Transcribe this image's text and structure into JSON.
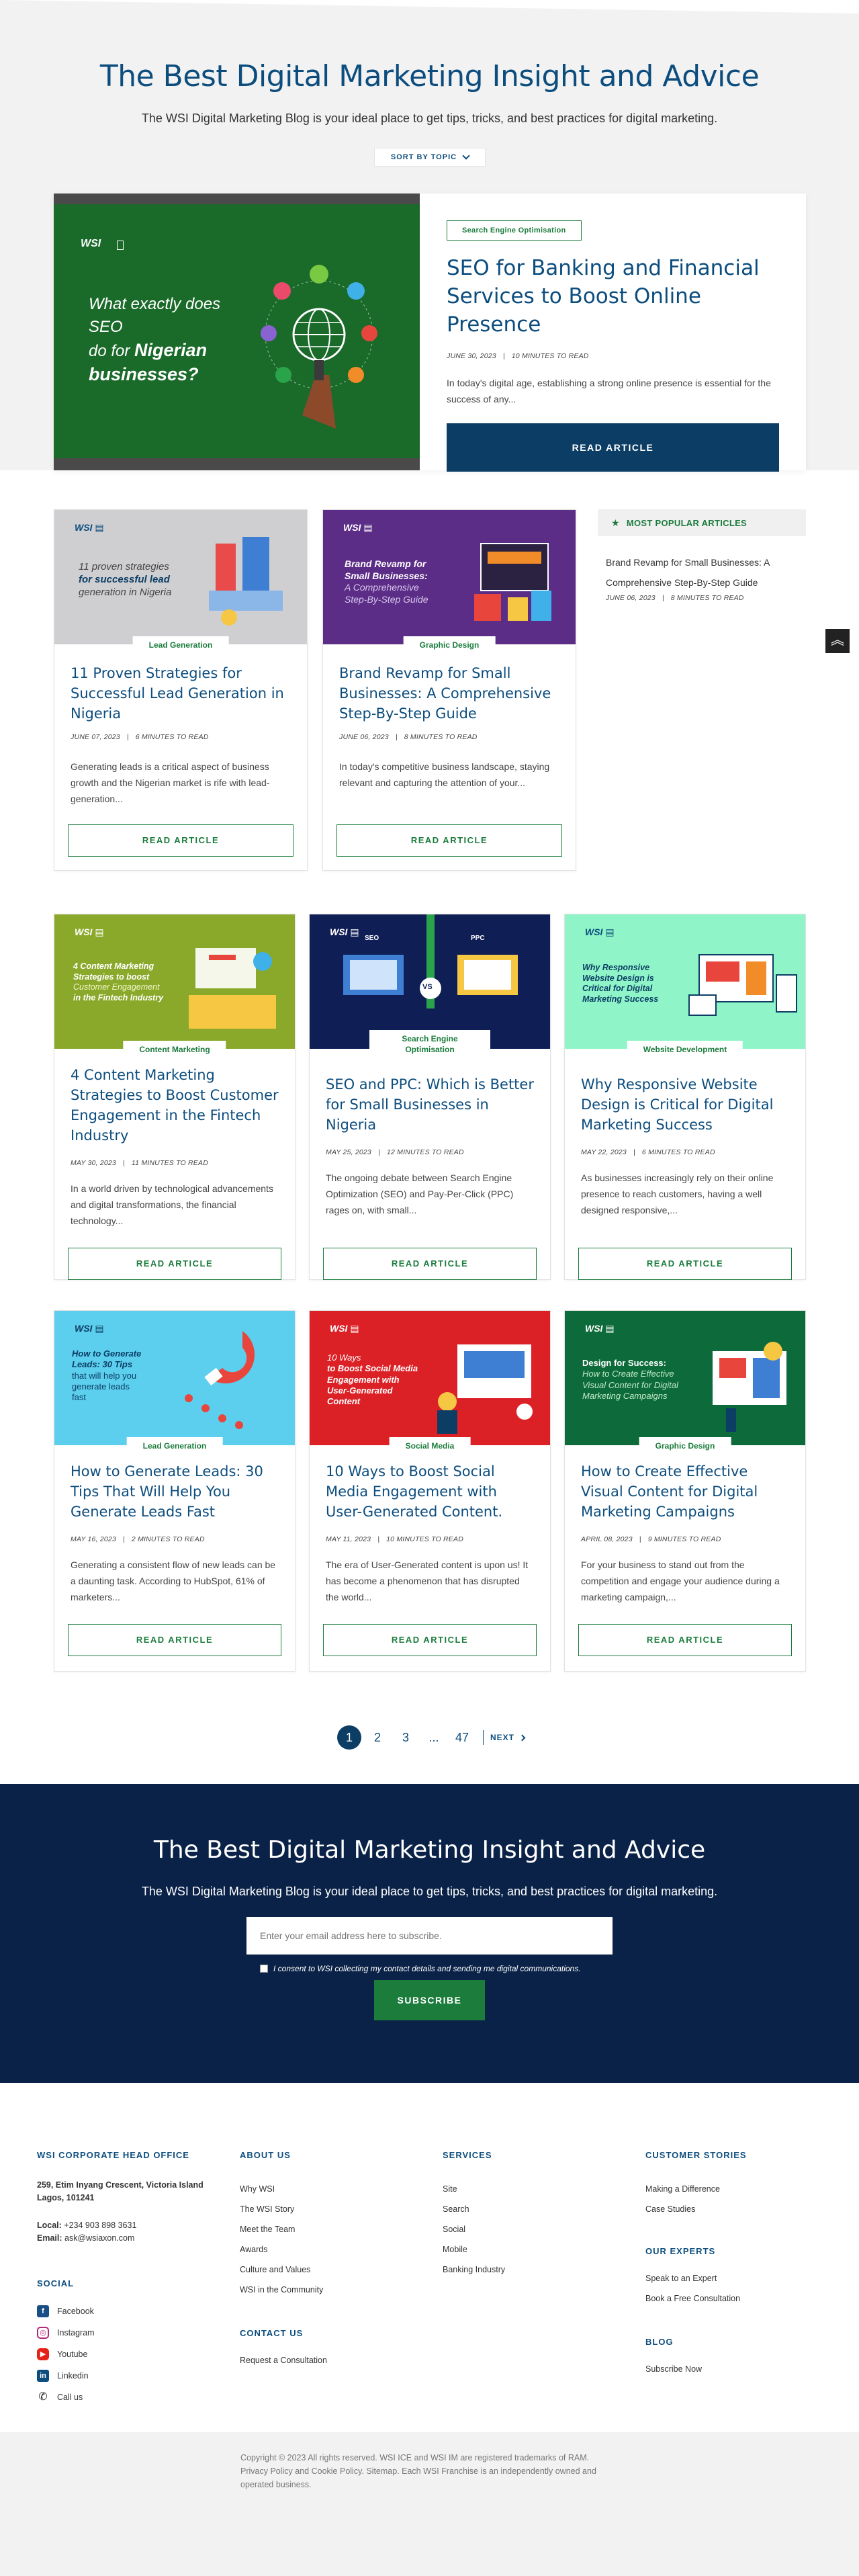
{
  "hero": {
    "title": "The Best Digital Marketing Insight and Advice",
    "subtitle": "The WSI Digital Marketing Blog is your ideal place to get tips, tricks, and best practices for digital marketing.",
    "sort_label": "SORT BY TOPIC"
  },
  "featured": {
    "tag": "Search Engine Optimisation",
    "title": "SEO for Banking and Financial Services to Boost Online Presence",
    "date": "JUNE 30, 2023",
    "read_time": "10 MINUTES TO READ",
    "excerpt": "In today's digital age, establishing a strong online presence is essential for the success of any...",
    "button": "READ ARTICLE",
    "image": {
      "logo": "WSI",
      "headline_1": "What exactly does SEO",
      "headline_2": "do for",
      "headline_3": "Nigerian",
      "headline_4": "businesses?",
      "center": "SEO",
      "bg_color": "#1a6a2a"
    }
  },
  "popular": {
    "heading": "MOST POPULAR ARTICLES",
    "title": "Brand Revamp for Small Businesses: A Comprehensive Step-By-Step Guide",
    "date": "JUNE 06, 2023",
    "read_time": "8 MINUTES TO READ"
  },
  "cards": [
    {
      "category": "Lead Generation",
      "title": "11 Proven Strategies for Successful Lead Generation in Nigeria",
      "date": "JUNE 07, 2023",
      "read_time": "6 MINUTES TO READ",
      "excerpt": "Generating leads is a critical aspect of business growth and the Nigerian market is rife with lead-generation...",
      "button": "READ ARTICLE",
      "img_bg": "#cfcfd2",
      "img_lines": [
        "11 proven strategies",
        "for successful lead",
        "generation in Nigeria"
      ]
    },
    {
      "category": "Graphic Design",
      "title": "Brand Revamp for Small Businesses: A Comprehensive Step-By-Step Guide",
      "date": "JUNE 06, 2023",
      "read_time": "8 MINUTES TO READ",
      "excerpt": "In today's competitive business landscape, staying relevant and capturing the attention of your...",
      "button": "READ ARTICLE",
      "img_bg": "#5b2d86",
      "img_lines": [
        "Brand Revamp for",
        "Small Businesses:",
        "A Comprehensive",
        "Step-By-Step Guide"
      ]
    },
    {
      "category": "Content Marketing",
      "title": "4 Content Marketing Strategies to Boost Customer Engagement in the Fintech Industry",
      "date": "MAY 30, 2023",
      "read_time": "11 MINUTES TO READ",
      "excerpt": "In a world driven by technological advancements and digital transformations, the financial technology...",
      "button": "READ ARTICLE",
      "img_bg": "#8aa92a",
      "img_lines": [
        "4 Content Marketing",
        "Strategies to boost",
        "Customer Engagement",
        "in the Fintech Industry"
      ]
    },
    {
      "category": "Search Engine Optimisation",
      "title": "SEO and PPC: Which is Better for Small Businesses in Nigeria",
      "date": "MAY 25, 2023",
      "read_time": "12 MINUTES TO READ",
      "excerpt": "The ongoing debate between Search Engine Optimization (SEO) and Pay-Per-Click (PPC) rages on, with small...",
      "button": "READ ARTICLE",
      "img_bg": "#0f1e55",
      "img_lines": [
        "SEO",
        "VS",
        "PPC"
      ]
    },
    {
      "category": "Website Development",
      "title": "Why Responsive Website Design is Critical for Digital Marketing Success",
      "date": "MAY 22, 2023",
      "read_time": "6 MINUTES TO READ",
      "excerpt": "As businesses increasingly rely on their online presence to reach customers, having a well designed responsive,...",
      "button": "READ ARTICLE",
      "img_bg": "#8ff5c8",
      "img_lines": [
        "Why Responsive",
        "Website Design is",
        "Critical for Digital",
        "Marketing Success"
      ]
    },
    {
      "category": "Lead Generation",
      "title": "How to Generate Leads: 30 Tips That Will Help You Generate Leads Fast",
      "date": "MAY 16, 2023",
      "read_time": "2 MINUTES TO READ",
      "excerpt": "Generating a consistent flow of new leads can be a daunting task. According to HubSpot, 61% of marketers...",
      "button": "READ ARTICLE",
      "img_bg": "#5ccfee",
      "img_lines": [
        "How to Generate",
        "Leads: 30 Tips",
        "that will help you",
        "generate leads",
        "fast"
      ]
    },
    {
      "category": "Social Media",
      "title": "10 Ways to Boost Social Media Engagement with User-Generated Content.",
      "date": "MAY 11, 2023",
      "read_time": "10 MINUTES TO READ",
      "excerpt": "The era of User-Generated content is upon us! It has become a phenomenon that has disrupted the world...",
      "button": "READ ARTICLE",
      "img_bg": "#dc2126",
      "img_lines": [
        "10 Ways",
        "to Boost Social Media",
        "Engagement with",
        "User-Generated",
        "Content"
      ]
    },
    {
      "category": "Graphic Design",
      "title": "How to Create Effective Visual Content for Digital Marketing Campaigns",
      "date": "APRIL 08, 2023",
      "read_time": "9 MINUTES TO READ",
      "excerpt": "For your business to stand out from the competition and engage your audience during a marketing campaign,...",
      "button": "READ ARTICLE",
      "img_bg": "#0d6a3a",
      "img_lines": [
        "Design for Success:",
        "How to Create Effective",
        "Visual Content for Digital",
        "Marketing Campaigns"
      ]
    }
  ],
  "pagination": {
    "pages": [
      "1",
      "2",
      "3"
    ],
    "ellipsis": "...",
    "last": "47",
    "next": "NEXT"
  },
  "subscribe": {
    "title": "The Best Digital Marketing Insight and Advice",
    "subtitle": "The WSI Digital Marketing Blog is your ideal place to get tips, tricks, and best practices for digital marketing.",
    "placeholder": "Enter your email address here to subscribe.",
    "consent": "I consent to WSI collecting my contact details and sending me digital communications.",
    "button": "SUBSCRIBE"
  },
  "footer": {
    "office": {
      "heading": "WSI CORPORATE HEAD OFFICE",
      "address_1": "259, Etim Inyang Crescent, Victoria Island",
      "address_2": "Lagos, 101241",
      "local_label": "Local:",
      "local": "+234 903 898 3631",
      "email_label": "Email:",
      "email": "ask@wsiaxon.com"
    },
    "social": {
      "heading": "SOCIAL",
      "items": [
        "Facebook",
        "Instagram",
        "Youtube",
        "Linkedin",
        "Call us"
      ]
    },
    "about": {
      "heading": "ABOUT US",
      "items": [
        "Why WSI",
        "The WSI Story",
        "Meet the Team",
        "Awards",
        "Culture and Values",
        "WSI in the Community"
      ]
    },
    "contact": {
      "heading": "CONTACT US",
      "items": [
        "Request a Consultation"
      ]
    },
    "services": {
      "heading": "SERVICES",
      "items": [
        "Site",
        "Search",
        "Social",
        "Mobile",
        "Banking Industry"
      ]
    },
    "stories": {
      "heading": "CUSTOMER STORIES",
      "items": [
        "Making a Difference",
        "Case Studies"
      ]
    },
    "experts": {
      "heading": "OUR EXPERTS",
      "items": [
        "Speak to an Expert",
        "Book a Free Consultation"
      ]
    },
    "blog": {
      "heading": "BLOG",
      "items": [
        "Subscribe Now"
      ]
    },
    "copyright": "Copyright © 2023 All rights reserved. WSI ICE and WSI IM are registered trademarks of RAM. Privacy Policy and Cookie Policy. Sitemap. Each WSI Franchise is an independently owned and operated business."
  }
}
